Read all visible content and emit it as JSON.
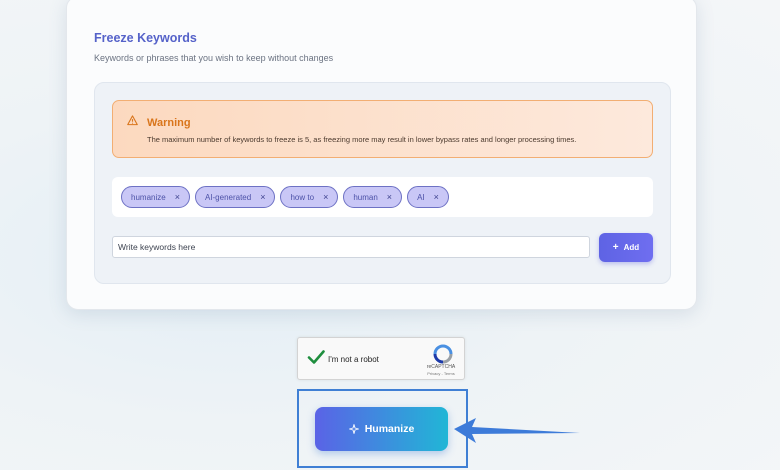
{
  "freeze": {
    "title": "Freeze Keywords",
    "subtitle": "Keywords or phrases that you wish to keep without changes"
  },
  "warning": {
    "icon": "warning-triangle-icon",
    "title": "Warning",
    "text": "The maximum number of keywords to freeze is 5, as freezing more may result in lower bypass rates and longer processing times."
  },
  "keywords": [
    {
      "label": "humanize",
      "remove": "×"
    },
    {
      "label": "AI-generated",
      "remove": "×"
    },
    {
      "label": "how to",
      "remove": "×"
    },
    {
      "label": "human",
      "remove": "×"
    },
    {
      "label": "AI",
      "remove": "×"
    }
  ],
  "input": {
    "value": "",
    "placeholder": "Write keywords here"
  },
  "add_button": {
    "icon": "plus-icon",
    "label": "Add"
  },
  "captcha": {
    "label": "I'm not a robot",
    "brand": "reCAPTCHA",
    "links": "Privacy - Terms",
    "state": "checked"
  },
  "humanize_button": {
    "icon": "sparkle-icon",
    "label": "Humanize"
  },
  "colors": {
    "accent": "#5e63e4",
    "title": "#5562c9",
    "warning": "#d9751b",
    "chip_bg": "#c9c7f6",
    "highlight": "#3f7fd4"
  }
}
